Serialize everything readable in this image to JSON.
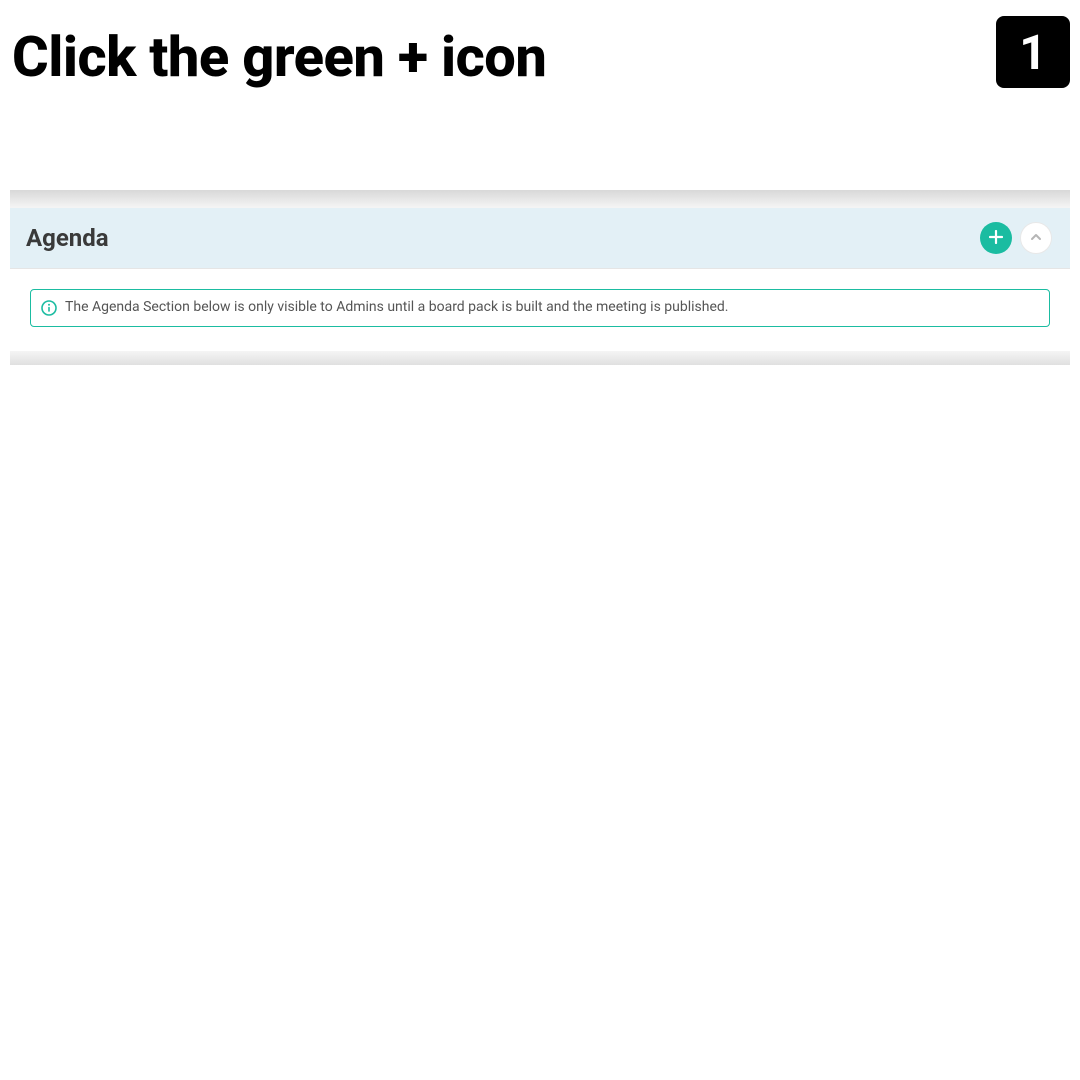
{
  "header": {
    "title": "Click the green + icon",
    "step_number": "1"
  },
  "panel": {
    "agenda_title": "Agenda",
    "info_message": "The Agenda Section below is only visible to Admins until a board pack is built and the meeting is published."
  },
  "colors": {
    "accent": "#1bbca1",
    "header_bg": "#e3f0f6"
  }
}
